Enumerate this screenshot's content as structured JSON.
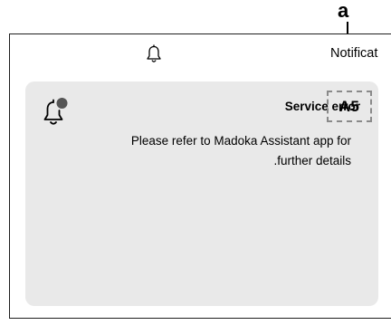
{
  "callout": {
    "label": "a"
  },
  "header": {
    "icon": "bell-icon",
    "title": "Notificat"
  },
  "notification": {
    "icon": "bell-with-badge-icon",
    "title": "Service error",
    "error_code": "A5",
    "message_line1": "Please refer to Madoka Assistant app for",
    "message_line2": ".further details"
  },
  "colors": {
    "card_background": "#e9e9e9",
    "badge": "#555555",
    "frame_border": "#1e1e1e",
    "error_code_border": "#8a8a8a"
  }
}
